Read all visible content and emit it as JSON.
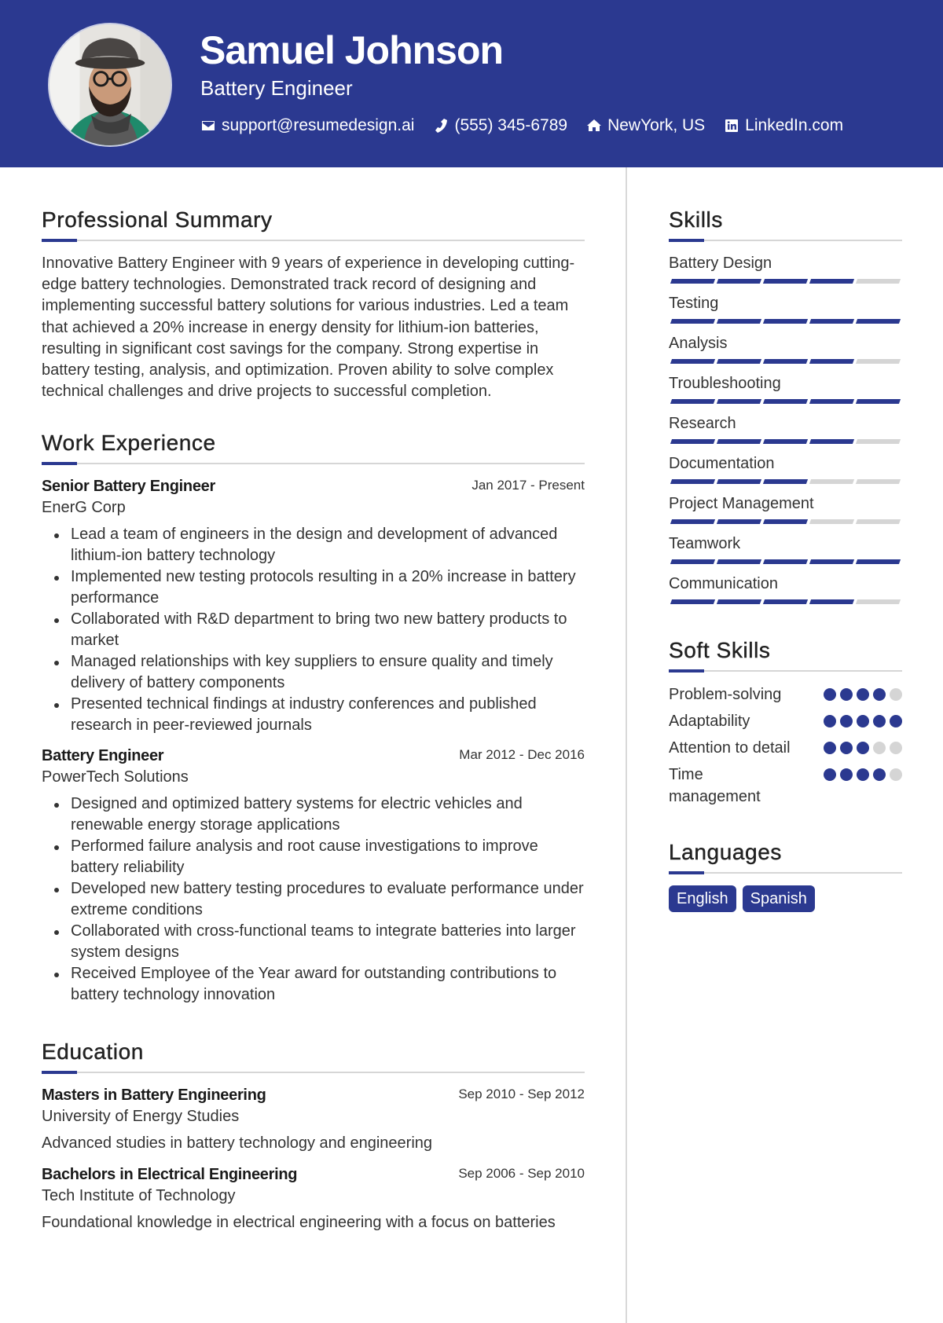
{
  "header": {
    "name": "Samuel Johnson",
    "title": "Battery Engineer",
    "photo_icon": "profile-photo",
    "contacts": [
      {
        "icon": "envelope-icon",
        "text": "support@resumedesign.ai"
      },
      {
        "icon": "phone-icon",
        "text": "(555) 345-6789"
      },
      {
        "icon": "home-icon",
        "text": "NewYork, US"
      },
      {
        "icon": "linkedin-icon",
        "text": "LinkedIn.com"
      }
    ]
  },
  "colors": {
    "accent": "#2b3990",
    "inactive": "#d5d5d5",
    "rule": "#d6d6d6"
  },
  "summary": {
    "heading": "Professional Summary",
    "text": "Innovative Battery Engineer with 9 years of experience in developing cutting-edge battery technologies. Demonstrated track record of designing and implementing successful battery solutions for various industries. Led a team that achieved a 20% increase in energy density for lithium-ion batteries, resulting in significant cost savings for the company. Strong expertise in battery testing, analysis, and optimization. Proven ability to solve complex technical challenges and drive projects to successful completion."
  },
  "experience": {
    "heading": "Work Experience",
    "jobs": [
      {
        "title": "Senior Battery Engineer",
        "company": "EnerG Corp",
        "dates": "Jan 2017 - Present",
        "bullets": [
          "Lead a team of engineers in the design and development of advanced lithium-ion battery technology",
          "Implemented new testing protocols resulting in a 20% increase in battery performance",
          "Collaborated with R&D department to bring two new battery products to market",
          "Managed relationships with key suppliers to ensure quality and timely delivery of battery components",
          "Presented technical findings at industry conferences and published research in peer-reviewed journals"
        ]
      },
      {
        "title": "Battery Engineer",
        "company": "PowerTech Solutions",
        "dates": "Mar 2012 - Dec 2016",
        "bullets": [
          "Designed and optimized battery systems for electric vehicles and renewable energy storage applications",
          "Performed failure analysis and root cause investigations to improve battery reliability",
          "Developed new battery testing procedures to evaluate performance under extreme conditions",
          "Collaborated with cross-functional teams to integrate batteries into larger system designs",
          "Received Employee of the Year award for outstanding contributions to battery technology innovation"
        ]
      }
    ]
  },
  "education": {
    "heading": "Education",
    "items": [
      {
        "degree": "Masters in Battery Engineering",
        "school": "University of Energy Studies",
        "dates": "Sep 2010 - Sep 2012",
        "description": "Advanced studies in battery technology and engineering"
      },
      {
        "degree": "Bachelors in Electrical Engineering",
        "school": "Tech Institute of Technology",
        "dates": "Sep 2006 - Sep 2010",
        "description": "Foundational knowledge in electrical engineering with a focus on batteries"
      }
    ]
  },
  "skills": {
    "heading": "Skills",
    "max": 5,
    "items": [
      {
        "name": "Battery Design",
        "level": 4
      },
      {
        "name": "Testing",
        "level": 5
      },
      {
        "name": "Analysis",
        "level": 4
      },
      {
        "name": "Troubleshooting",
        "level": 5
      },
      {
        "name": "Research",
        "level": 4
      },
      {
        "name": "Documentation",
        "level": 3
      },
      {
        "name": "Project Management",
        "level": 3
      },
      {
        "name": "Teamwork",
        "level": 5
      },
      {
        "name": "Communication",
        "level": 4
      }
    ]
  },
  "soft_skills": {
    "heading": "Soft Skills",
    "max": 5,
    "items": [
      {
        "name": "Problem-solving",
        "level": 4
      },
      {
        "name": "Adaptability",
        "level": 5
      },
      {
        "name": "Attention to detail",
        "level": 3
      },
      {
        "name": "Time management",
        "level": 4
      }
    ]
  },
  "languages": {
    "heading": "Languages",
    "items": [
      "English",
      "Spanish"
    ]
  }
}
